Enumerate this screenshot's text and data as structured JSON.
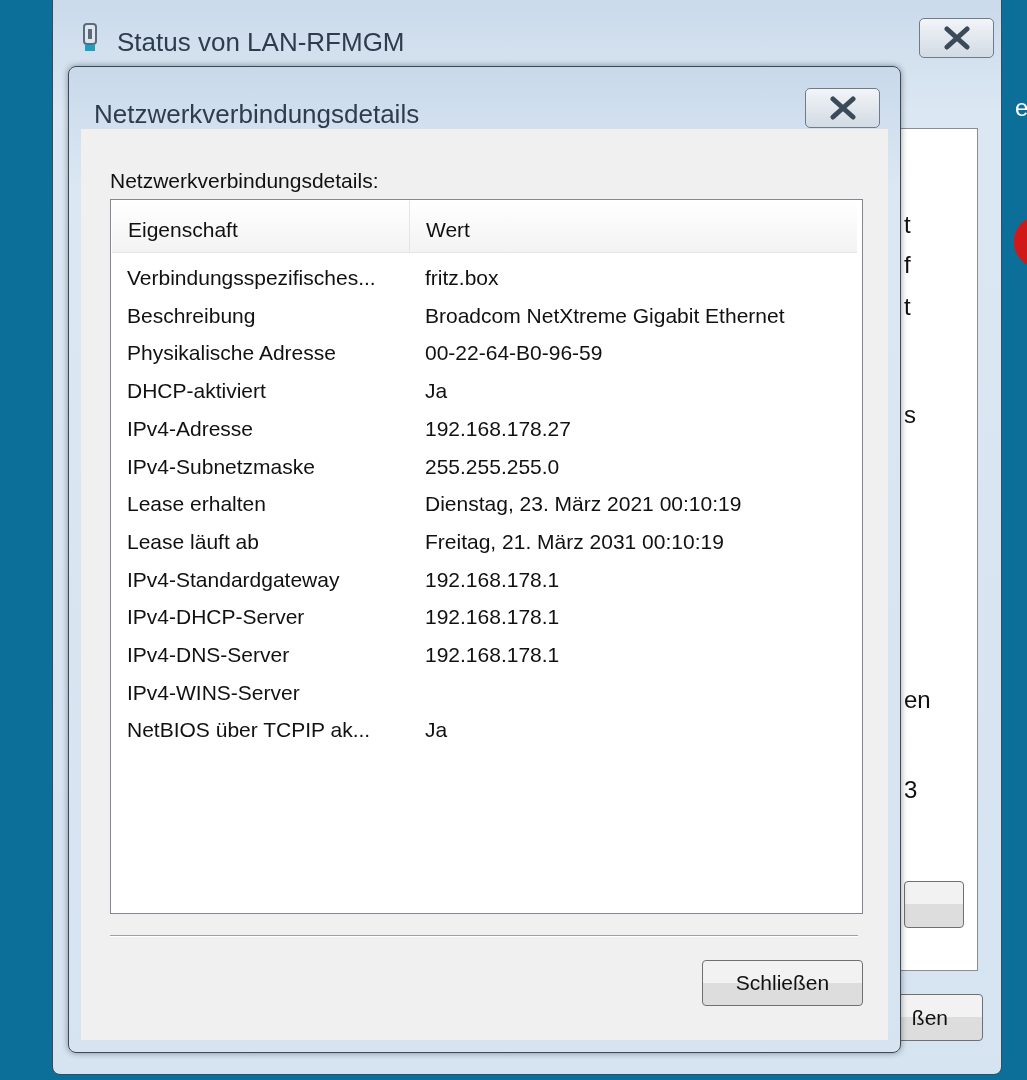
{
  "desktop": {
    "fragments": [
      "e"
    ]
  },
  "back_window": {
    "title": "Status von LAN-RFMGM",
    "fragments": [
      "t",
      "f",
      "t",
      "s",
      "en",
      "3"
    ],
    "button": "ßen"
  },
  "dialog": {
    "title": "Netzwerkverbindungsdetails",
    "label": "Netzwerkverbindungsdetails:",
    "table": {
      "columns": [
        "Eigenschaft",
        "Wert"
      ],
      "rows": [
        [
          "Verbindungsspezifisches...",
          "fritz.box"
        ],
        [
          "Beschreibung",
          "Broadcom NetXtreme Gigabit Ethernet"
        ],
        [
          "Physikalische Adresse",
          "00-22-64-B0-96-59"
        ],
        [
          "DHCP-aktiviert",
          "Ja"
        ],
        [
          "IPv4-Adresse",
          "192.168.178.27"
        ],
        [
          "IPv4-Subnetzmaske",
          "255.255.255.0"
        ],
        [
          "Lease erhalten",
          "Dienstag, 23. März 2021 00:10:19"
        ],
        [
          "Lease läuft ab",
          "Freitag, 21. März 2031 00:10:19"
        ],
        [
          "IPv4-Standardgateway",
          "192.168.178.1"
        ],
        [
          "IPv4-DHCP-Server",
          "192.168.178.1"
        ],
        [
          "IPv4-DNS-Server",
          "192.168.178.1"
        ],
        [
          "IPv4-WINS-Server",
          ""
        ],
        [
          "NetBIOS über TCPIP ak...",
          "Ja"
        ]
      ]
    },
    "button": "Schließen"
  }
}
